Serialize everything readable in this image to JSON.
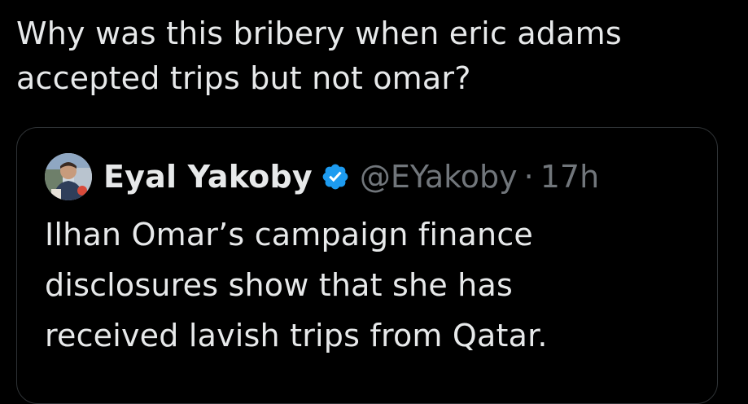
{
  "tweet": {
    "text_line1": "Why was this bribery when eric adams",
    "text_line2": "accepted trips but not omar?"
  },
  "quote": {
    "author_name": "Eyal Yakoby",
    "handle": "@EYakoby",
    "separator": "·",
    "time": "17h",
    "text_line1": "Ilhan Omar’s campaign finance",
    "text_line2": "disclosures show that she has",
    "text_line3": "received lavish trips from Qatar.",
    "avatar_icon": "user-avatar-photo",
    "verified_icon": "verified-badge-icon"
  },
  "colors": {
    "background": "#000000",
    "primary_text": "#e7e9ea",
    "secondary_text": "#71767b",
    "card_border": "#2f3336",
    "verified_blue": "#1d9bf0"
  }
}
